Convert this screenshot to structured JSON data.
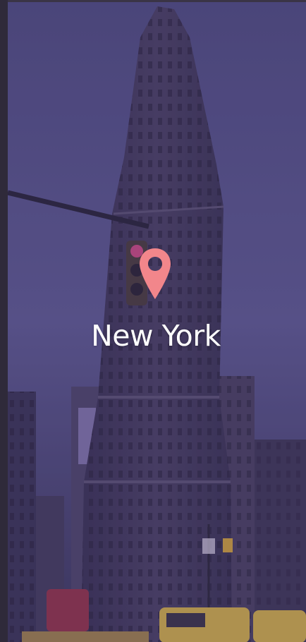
{
  "location": {
    "city_name": "New York",
    "pin_icon": "location-pin-icon",
    "pin_color": "#f2868b"
  },
  "background": {
    "subject": "flatiron-building-photo",
    "tint_color": "#57518a"
  }
}
